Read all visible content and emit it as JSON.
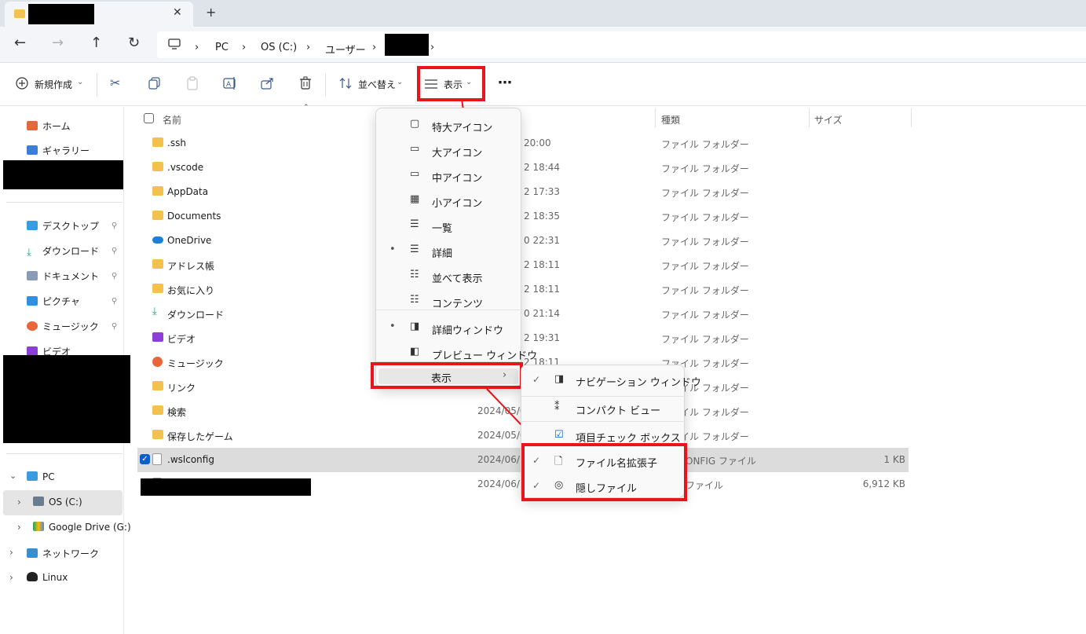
{
  "tabbar": {
    "close_icon": "✕",
    "new_tab_icon": "+"
  },
  "nav": {
    "back_icon": "←",
    "forward_icon": "→",
    "up_icon": "↑",
    "refresh_icon": "↻",
    "sep_icon": "›",
    "breadcrumb": [
      "PC",
      "OS (C:)",
      "ユーザー"
    ]
  },
  "toolbar": {
    "new_label": "新規作成",
    "sort_label": "並べ替え",
    "view_label": "表示",
    "more_label": "⋯",
    "icons": [
      "cut-icon",
      "copy-icon",
      "paste-icon",
      "rename-icon",
      "share-icon",
      "delete-icon"
    ]
  },
  "sidebar": {
    "top": [
      "ホーム",
      "ギャラリー"
    ],
    "quick": [
      "デスクトップ",
      "ダウンロード",
      "ドキュメント",
      "ピクチャ",
      "ミュージック",
      "ビデオ"
    ],
    "tree": [
      "PC",
      "OS (C:)",
      "Google Drive (G:)",
      "ネットワーク",
      "Linux"
    ],
    "pin_icon": "📌",
    "expand_icon": "›",
    "collapse_icon": "⌄"
  },
  "columns": {
    "name": "名前",
    "type": "種類",
    "size": "サイズ"
  },
  "files": [
    {
      "name": ".ssh",
      "date": "20:00",
      "type": "ファイル フォルダー",
      "size": ""
    },
    {
      "name": ".vscode",
      "date": "2 18:44",
      "type": "ファイル フォルダー",
      "size": ""
    },
    {
      "name": "AppData",
      "date": "2 17:33",
      "type": "ファイル フォルダー",
      "size": ""
    },
    {
      "name": "Documents",
      "date": "2 18:35",
      "type": "ファイル フォルダー",
      "size": ""
    },
    {
      "name": "OneDrive",
      "date": "0 22:31",
      "type": "ファイル フォルダー",
      "size": ""
    },
    {
      "name": "アドレス帳",
      "date": "2 18:11",
      "type": "ファイル フォルダー",
      "size": ""
    },
    {
      "name": "お気に入り",
      "date": "2 18:11",
      "type": "ファイル フォルダー",
      "size": ""
    },
    {
      "name": "ダウンロード",
      "date": "0 21:14",
      "type": "ファイル フォルダー",
      "size": ""
    },
    {
      "name": "ビデオ",
      "date": "2 19:31",
      "type": "ファイル フォルダー",
      "size": ""
    },
    {
      "name": "ミュージック",
      "date": "2 18:11",
      "type": "ファイル フォルダー",
      "size": ""
    },
    {
      "name": "リンク",
      "date": "",
      "type": "ファイル フォルダー",
      "size": ""
    },
    {
      "name": "検索",
      "date": "2024/05/02",
      "type": "ファイル フォルダー",
      "size": ""
    },
    {
      "name": "保存したゲーム",
      "date": "2024/05/02",
      "type": "ファイル フォルダー",
      "size": ""
    },
    {
      "name": ".wslconfig",
      "date": "2024/06/16",
      "type": "ONFIG ファイル",
      "size": "1 KB"
    },
    {
      "name": "",
      "date": "2024/06/16",
      "type": "ファイル",
      "size": "6,912 KB"
    }
  ],
  "view_menu": {
    "items": [
      "特大アイコン",
      "大アイコン",
      "中アイコン",
      "小アイコン",
      "一覧",
      "詳細",
      "並べて表示",
      "コンテンツ",
      "詳細ウィンドウ",
      "プレビュー ウィンドウ"
    ],
    "show_label": "表示",
    "bullet": "•",
    "chevron": "›"
  },
  "show_menu": {
    "items": [
      "ナビゲーション ウィンドウ",
      "コンパクト ビュー",
      "項目チェック ボックス",
      "ファイル名拡張子",
      "隠しファイル"
    ],
    "check": "✓"
  },
  "colors": {
    "highlight": "#e8161c",
    "folder": "#f2c14e",
    "accent": "#0a5fc9"
  }
}
